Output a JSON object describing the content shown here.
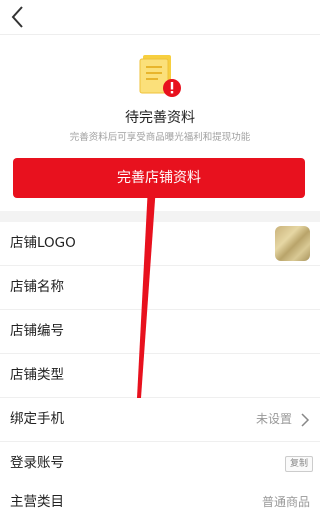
{
  "header": {
    "back_icon": "chevron-left-icon"
  },
  "hero": {
    "icon": "document-alert-icon",
    "title": "待完善资料",
    "subtitle": "完善资料后可享受商品曝光福利和提现功能",
    "button_label": "完善店铺资料",
    "accent_color": "#e8111e"
  },
  "fields": {
    "logo": {
      "label": "店铺LOGO"
    },
    "name": {
      "label": "店铺名称"
    },
    "number": {
      "label": "店铺编号"
    },
    "type": {
      "label": "店铺类型"
    },
    "phone": {
      "label": "绑定手机",
      "value": "未设置"
    },
    "account": {
      "label": "登录账号",
      "copy_label": "复制"
    },
    "category": {
      "label": "主营类目",
      "value": "普通商品"
    }
  }
}
